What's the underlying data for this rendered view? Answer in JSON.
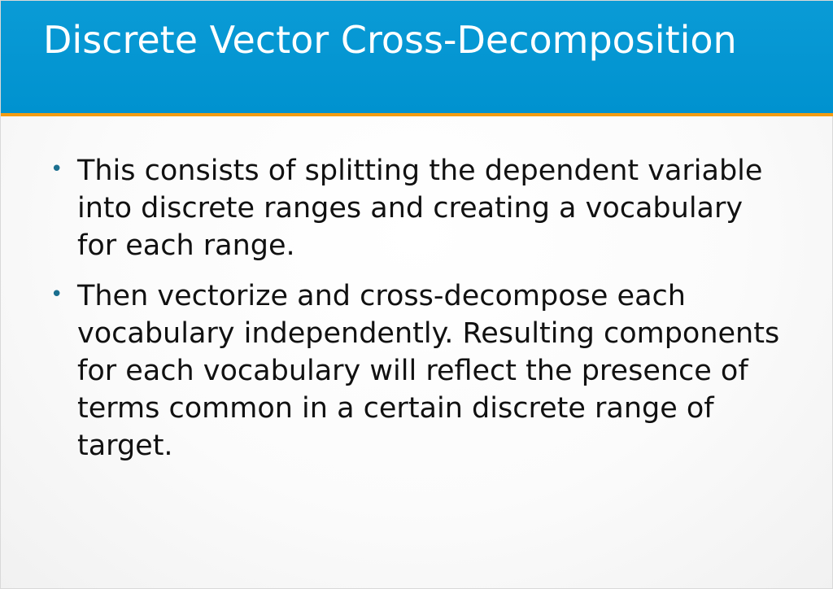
{
  "slide": {
    "title": "Discrete Vector Cross-Decomposition",
    "bullets": [
      {
        "text": "This consists of splitting the dependent variable into discrete ranges and creating a vocabulary for each range."
      },
      {
        "text": "Then vectorize and cross-decompose each vocabulary independently. Resulting components for each vocabulary will reflect the presence of terms common in a certain discrete range of target."
      }
    ]
  },
  "colors": {
    "title_bar": "#0096d2",
    "title_accent": "#f39c12",
    "title_text": "#ffffff",
    "body_text": "#111111",
    "bullet": "#1b6f8f"
  }
}
